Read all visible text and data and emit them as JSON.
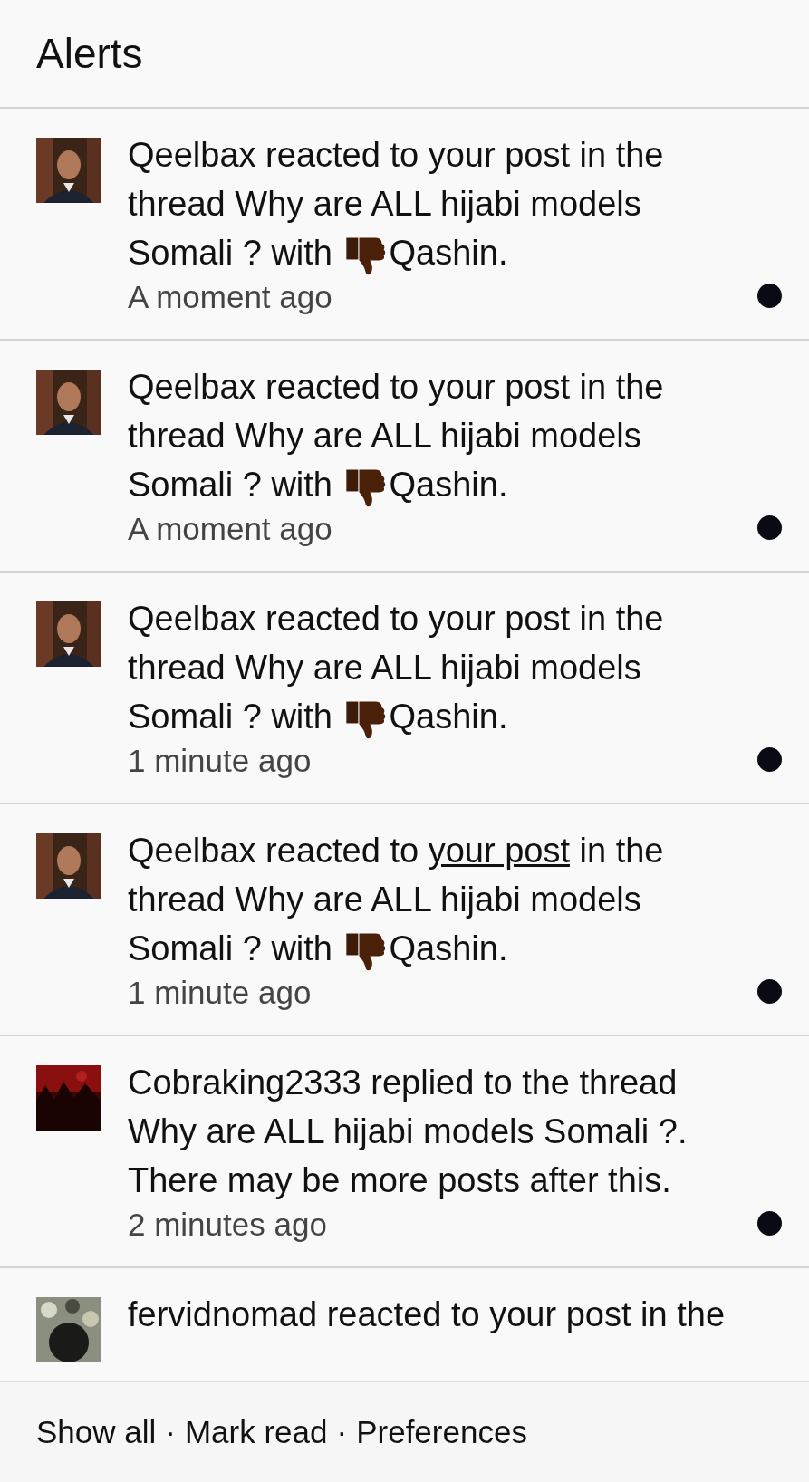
{
  "header": {
    "title": "Alerts"
  },
  "alerts": [
    {
      "avatar": {
        "kind": "picture"
      },
      "parts": [
        {
          "kind": "text",
          "text": "Qeelbax reacted to your post in the thread Why are ALL hijabi models Somali ? with "
        },
        {
          "kind": "reaction",
          "text": "Qashin."
        }
      ],
      "time": "A moment ago",
      "unread": true
    },
    {
      "avatar": {
        "kind": "picture"
      },
      "parts": [
        {
          "kind": "text",
          "text": "Qeelbax reacted to your post in the thread Why are ALL hijabi models Somali ? with "
        },
        {
          "kind": "reaction",
          "text": "Qashin."
        }
      ],
      "time": "A moment ago",
      "unread": true
    },
    {
      "avatar": {
        "kind": "picture"
      },
      "parts": [
        {
          "kind": "text",
          "text": "Qeelbax reacted to your post in the thread Why are ALL hijabi models Somali ? with "
        },
        {
          "kind": "reaction",
          "text": "Qashin."
        }
      ],
      "time": "1 minute ago",
      "unread": true
    },
    {
      "avatar": {
        "kind": "picture"
      },
      "parts": [
        {
          "kind": "text",
          "text": "Qeelbax reacted to "
        },
        {
          "kind": "link",
          "text": "your post"
        },
        {
          "kind": "text",
          "text": " in the thread Why are ALL hijabi models Somali ? with "
        },
        {
          "kind": "reaction",
          "text": "Qashin."
        }
      ],
      "time": "1 minute ago",
      "unread": true
    },
    {
      "avatar": {
        "kind": "picture"
      },
      "parts": [
        {
          "kind": "text",
          "text": "Cobraking2333 replied to the thread Why are ALL hijabi models Somali ?. There may be more posts after this."
        }
      ],
      "time": "2 minutes ago",
      "unread": true
    },
    {
      "avatar": {
        "kind": "picture"
      },
      "parts": [
        {
          "kind": "text",
          "text": "fervidnomad reacted to your post in the"
        }
      ]
    }
  ],
  "footer": {
    "links": [
      "Show all",
      "Mark read",
      "Preferences"
    ],
    "separator": "·"
  }
}
